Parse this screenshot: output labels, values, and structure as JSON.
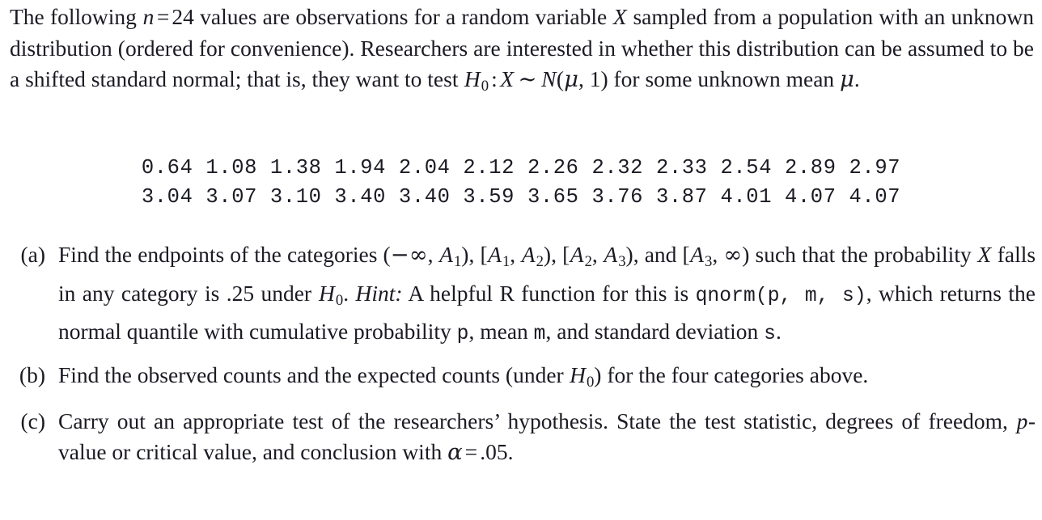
{
  "document": {
    "type": "statistics-problem",
    "intro": {
      "text_plain": "The following n = 24 values are observations for a random variable X sampled from a population with an unknown distribution (ordered for convenience). Researchers are interested in whether this distribution can be assumed to be a shifted standard normal; that is, they want to test H0 : X ~ N(mu, 1) for some unknown mean mu.",
      "seg_1": "The following ",
      "var_n": "n",
      "eq": "=",
      "sample_size": "24",
      "seg_2": " values are observations for a random variable ",
      "var_X": "X",
      "seg_3": " sampled from a population with an unknown distribution (ordered for convenience). Researchers are interested in whether this distribution can be assumed to be a shifted standard normal; that is, they want to test ",
      "var_H": "H",
      "sub_0": "0",
      "colon": ":",
      "var_X2": "X",
      "sim": "∼",
      "var_N": "N",
      "paren_open": "(",
      "mu": "μ",
      "comma": ",",
      "sigma_val": "1",
      "paren_close": ")",
      "seg_4": " for some unknown mean ",
      "mu2": "μ",
      "period": "."
    },
    "data": {
      "n": 24,
      "row1": "0.64 1.08 1.38 1.94 2.04 2.12 2.26 2.32 2.33 2.54 2.89 2.97",
      "row2": "3.04 3.07 3.10 3.40 3.40 3.59 3.65 3.76 3.87 4.01 4.07 4.07",
      "values": [
        0.64,
        1.08,
        1.38,
        1.94,
        2.04,
        2.12,
        2.26,
        2.32,
        2.33,
        2.54,
        2.89,
        2.97,
        3.04,
        3.07,
        3.1,
        3.4,
        3.4,
        3.59,
        3.65,
        3.76,
        3.87,
        4.01,
        4.07,
        4.07
      ]
    },
    "items": [
      {
        "label": "(a)",
        "text_plain": "Find the endpoints of the categories (-inf, A1), [A1, A2), [A2, A3), and [A3, inf) such that the probability X falls in any category is .25 under H0. Hint: A helpful R function for this is qnorm(p, m, s), which returns the normal quantile with cumulative probability p, mean m, and standard deviation s.",
        "seg_1": "Find the endpoints of the categories ",
        "interval_1_open": "(",
        "neg_inf": "−∞",
        "comma_1": ",",
        "A": "A",
        "sub_1": "1",
        "interval_1_close": ")",
        "comma_2": ",",
        "interval_2_open": "[",
        "sub_2": "2",
        "interval_2_close": ")",
        "interval_3_open": "[",
        "sub_3": "3",
        "interval_3_close": ")",
        "and": ", and ",
        "interval_4_open": "[",
        "inf": "∞",
        "interval_4_close": ")",
        "seg_2": " such that the probability ",
        "var_X": "X",
        "seg_3": " falls in any category is ",
        "probability": ".25",
        "seg_4": " under ",
        "var_H": "H",
        "sub_0": "0",
        "seg_5": ". ",
        "hint_label": "Hint:",
        "seg_6": " A helpful R function for this is ",
        "code_fn": "qnorm(p, m, s)",
        "seg_7": ", which returns the normal quantile with cumulative probability ",
        "code_p": "p",
        "seg_8": ", mean ",
        "code_m": "m",
        "seg_9": ", and standard deviation ",
        "code_s": "s",
        "seg_10": "."
      },
      {
        "label": "(b)",
        "text_plain": "Find the observed counts and the expected counts (under H0) for the four categories above.",
        "seg_1": "Find the observed counts and the expected counts (under ",
        "var_H": "H",
        "sub_0": "0",
        "seg_2": ") for the four categories above."
      },
      {
        "label": "(c)",
        "text_plain": "Carry out an appropriate test of the researchers' hypothesis. State the test statistic, degrees of freedom, p-value or critical value, and conclusion with alpha = .05.",
        "seg_1": "Carry out an appropriate test of the researchers’ hypothesis. State the test statistic, degrees of freedom, ",
        "var_p": "p",
        "seg_2": "-value or critical value, and conclusion with ",
        "alpha": "α",
        "eq": "=",
        "alpha_value": ".05",
        "seg_3": "."
      }
    ]
  }
}
